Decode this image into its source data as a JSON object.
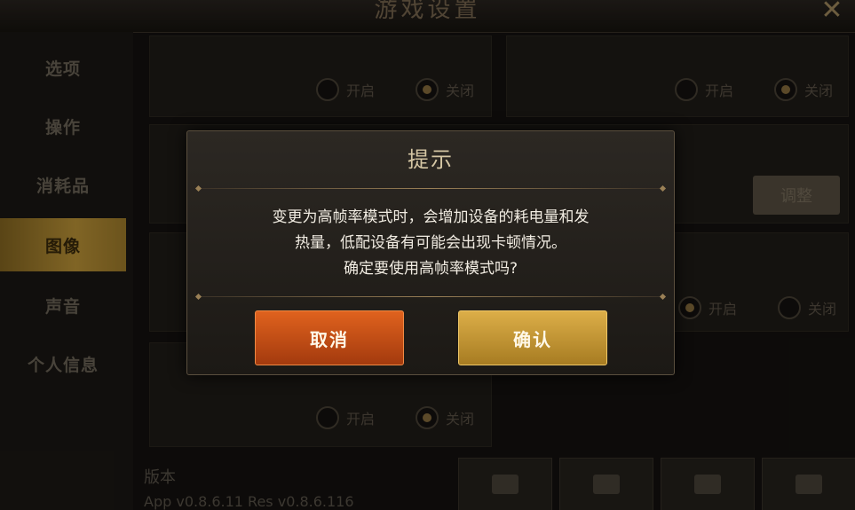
{
  "topbar": {
    "title": "游戏设置",
    "close_icon": "close-icon"
  },
  "sidebar": {
    "items": [
      {
        "label": "选项",
        "active": false
      },
      {
        "label": "操作",
        "active": false
      },
      {
        "label": "消耗品",
        "active": false
      },
      {
        "label": "图像",
        "active": true
      },
      {
        "label": "声音",
        "active": false
      },
      {
        "label": "个人信息",
        "active": false
      }
    ]
  },
  "settings": {
    "on_label": "开启",
    "off_label": "关闭",
    "adjust_button": "调整",
    "version_label": "版本",
    "version_text": "App v0.8.6.11 Res v0.8.6.116"
  },
  "dialog": {
    "title": "提示",
    "message_line1": "变更为高帧率模式时，会增加设备的耗电量和发",
    "message_line2": "热量，低配设备有可能会出现卡顿情况。",
    "message_line3": "确定要使用高帧率模式吗?",
    "cancel_label": "取消",
    "confirm_label": "确认"
  },
  "colors": {
    "accent_gold": "#c59b3a",
    "cancel_orange": "#d4571a",
    "confirm_gold": "#c99838"
  }
}
